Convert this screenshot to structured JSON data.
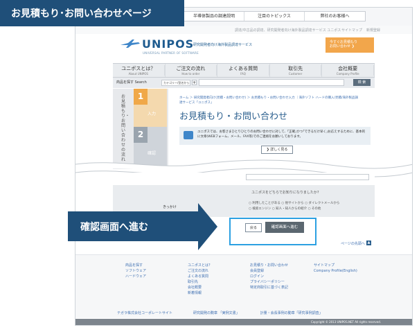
{
  "title_badge": "お見積もり･お問い合わせページ",
  "topnav": [
    "半導体製品の調達説明",
    "注目のトピックス",
    "弊社のお客様へ"
  ],
  "subnav": {
    "left": "調達/中古品の調達、研究開発者向け海外製品調達サービス ユニポス",
    "sitemap": "サイトマップ",
    "english": "新規登録"
  },
  "logo": {
    "name": "UNIPOS",
    "sub": "UNIVERSAL PARTNER OF SOFTWARE",
    "tagline": "研究開発者向け海外製品調達サービス"
  },
  "cta": {
    "line1": "今すぐお見積もり",
    "line2": "お問い合わせ ❯"
  },
  "mainnav": [
    {
      "j": "ユニポスとは？",
      "e": "About UNIPOS"
    },
    {
      "j": "ご注文の流れ",
      "e": "How to order"
    },
    {
      "j": "よくある質問",
      "e": "FAQ"
    },
    {
      "j": "取引先",
      "e": "Customer"
    },
    {
      "j": "会社概要",
      "e": "Company Profile"
    }
  ],
  "search": {
    "label": "商品を探す Search",
    "select": "カテゴリー/型名から",
    "plus": "+",
    "button": "検 索"
  },
  "side": {
    "title": "お見積もり・お問い合わせの流れ"
  },
  "steps": [
    {
      "num": "1",
      "label": "入力"
    },
    {
      "num": "2",
      "label": "確認"
    }
  ],
  "breadcrumb": "ホーム ＞ 研究開発者向け(見積・お問い合わせ) ＞ お見積もり・お問い合わせ入力 ｜海外ソフト ハードの購入/見積/海外製品調達サービス「ユニポス」",
  "page_title": "お見積もり・お問い合わせ",
  "info_text": "ユニポスでは、お客さまひとりひとりのお問い合わせに対して、｢正確｣かつ｢できるだけ早く｣お応えするために、基本的に文章(WEBフォーム、メール、FAX等)でのご連絡をお願いしております。",
  "more_button": "❯ 詳しく見る",
  "kikkake": {
    "label": "きっかけ",
    "question": "ユニポスをどちらでお知りになりましたか?",
    "opt1": "○ 利用したことがある ○ 他サイトから ○ ダイレクトメールから",
    "opt2": "○ 検索エンジン ○ 知人・知人からの紹介 ○ その他"
  },
  "back_button": "戻る",
  "confirm_button": "確認画面へ進む",
  "pagetop": "ページの先頭へ",
  "footer": {
    "col1": [
      "商品を探す",
      "ソフトウェア",
      "ハードウェア"
    ],
    "col2": [
      "ユニポスとは？",
      "ご注文の流れ",
      "よくある質問",
      "取引先",
      "会社概要",
      "新着情報"
    ],
    "col3": [
      "お見積り・お問い合わせ",
      "会員登録",
      "ログイン",
      "プライバシーポリシー",
      "特定商取引に基づく表記"
    ],
    "col4": [
      "サイトマップ",
      "Company Profile(English)"
    ],
    "bottom": [
      "テガラ株式会社コーポレートサイト",
      "研究開発の勲章 「実例文書」",
      "計量・会長事例の動章「研究事例調査」"
    ]
  },
  "copyright": "Copyright © 2013 UNIPOS.NET All rights reserved.",
  "overlay_label": "確認画面へ進む"
}
